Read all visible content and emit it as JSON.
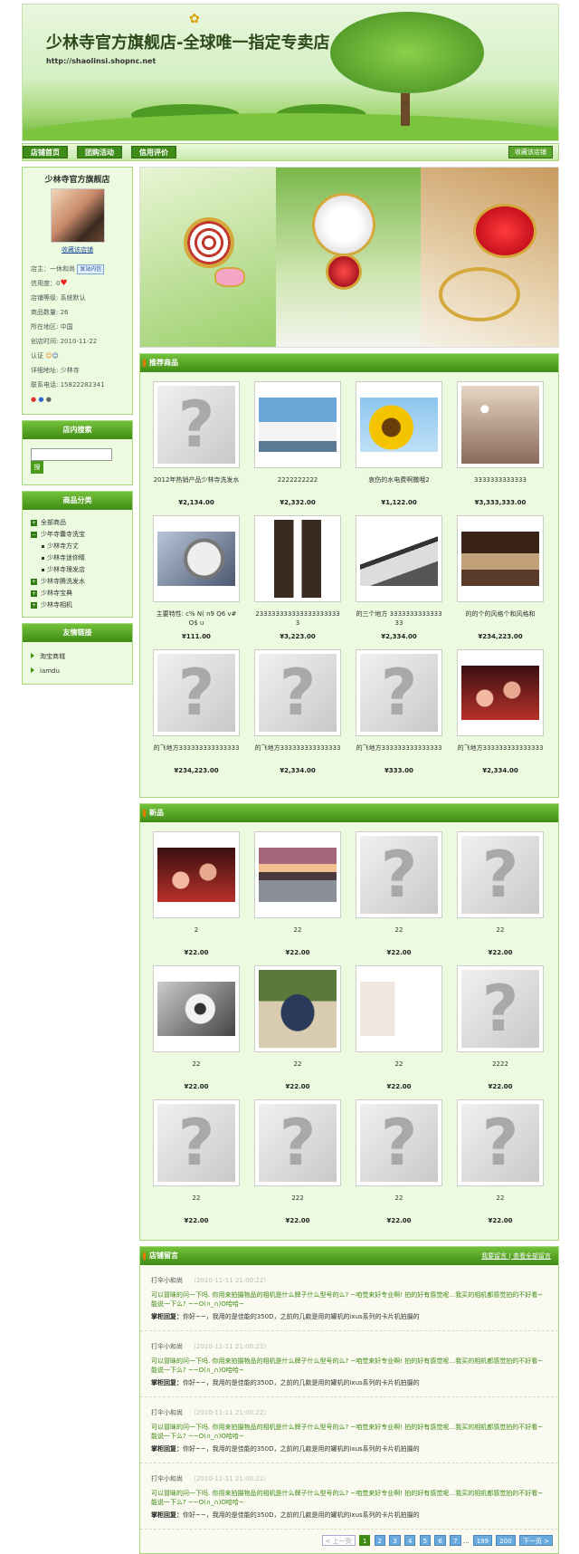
{
  "banner": {
    "title": "少林寺官方旗舰店-全球唯一指定专卖店",
    "url": "http://shaolinsi.shopnc.net"
  },
  "nav": {
    "items": [
      "店铺首页",
      "团购活动",
      "信用评价"
    ],
    "favorite": "收藏该店铺"
  },
  "shop": {
    "name": "少林寺官方旗舰店",
    "collect": "收藏该店铺",
    "owner_label": "店主：",
    "owner": "一休和尚",
    "im_tag": "发站内信",
    "credit_label": "信用度：",
    "credit": "0",
    "level": "店铺等级: 系统默认",
    "goods_count": "商品数量: 26",
    "region": "所在地区: 中国",
    "created": "创店时间: 2010-11-22",
    "verify_label": "认证",
    "address": "详细地址: 少林寺",
    "phone": "联系电话: 15822282341"
  },
  "search": {
    "title": "店内搜索",
    "button": "搜"
  },
  "categories": {
    "title": "商品分类",
    "items": [
      {
        "label": "全部商品",
        "type": "plus"
      },
      {
        "label": "少年寺囊寺洗宝",
        "type": "minus"
      },
      {
        "label": "少林寺方丈",
        "type": "sub"
      },
      {
        "label": "少林寺迷你睛",
        "type": "sub"
      },
      {
        "label": "少林寺理发店",
        "type": "sub"
      },
      {
        "label": "少林寺腾洗发水",
        "type": "plus"
      },
      {
        "label": "少林寺宝典",
        "type": "plus"
      },
      {
        "label": "少林寺相机",
        "type": "plus"
      }
    ]
  },
  "friend_links": {
    "title": "友情链接",
    "items": [
      "淘宝商城",
      "iamdu"
    ]
  },
  "recommended": {
    "title": "推荐商品",
    "goods": [
      {
        "name": "2012年热销产品少林寺洗发水",
        "price": "¥2,134.00",
        "img": "q"
      },
      {
        "name": "2222222222",
        "price": "¥2,332.00",
        "img": "lighthouse"
      },
      {
        "name": "哀伤的水电费啊撒哦2",
        "price": "¥1,122.00",
        "img": "sunflower"
      },
      {
        "name": "3333333333333",
        "price": "¥3,333,333.00",
        "img": "bokeh"
      },
      {
        "name": "主要特性: c% N( n9 Q6 v# O$ u",
        "price": "¥111.00",
        "img": "watch"
      },
      {
        "name": "2333333333333333333333",
        "price": "¥3,223.00",
        "img": "fashion"
      },
      {
        "name": "的三个地方 333333333333333",
        "price": "¥2,334.00",
        "img": "papers"
      },
      {
        "name": "的的个的风格个和风格和",
        "price": "¥234,223.00",
        "img": "room"
      },
      {
        "name": "的飞地方333333333333333",
        "price": "¥234,223.00",
        "img": "q"
      },
      {
        "name": "的飞地方333333333333333",
        "price": "¥2,334.00",
        "img": "q"
      },
      {
        "name": "的飞地方333333333333333",
        "price": "¥333.00",
        "img": "q"
      },
      {
        "name": "的飞地方333333333333333",
        "price": "¥2,334.00",
        "img": "party"
      }
    ]
  },
  "newgoods": {
    "title": "新品",
    "goods": [
      {
        "name": "2",
        "price": "¥22.00",
        "img": "party"
      },
      {
        "name": "22",
        "price": "¥22.00",
        "img": "sunset"
      },
      {
        "name": "22",
        "price": "¥22.00",
        "img": "q"
      },
      {
        "name": "22",
        "price": "¥22.00",
        "img": "q"
      },
      {
        "name": "22",
        "price": "¥22.00",
        "img": "flower"
      },
      {
        "name": "22",
        "price": "¥22.00",
        "img": "girl"
      },
      {
        "name": "22",
        "price": "¥22.00",
        "img": "ad"
      },
      {
        "name": "2222",
        "price": "¥22.00",
        "img": "q"
      },
      {
        "name": "22",
        "price": "¥22.00",
        "img": "q"
      },
      {
        "name": "222",
        "price": "¥22.00",
        "img": "q"
      },
      {
        "name": "22",
        "price": "¥22.00",
        "img": "q"
      },
      {
        "name": "22",
        "price": "¥22.00",
        "img": "q"
      }
    ]
  },
  "messages": {
    "title": "店铺留言",
    "link_my": "我要留言",
    "link_all": "查看全部留言",
    "items": [
      {
        "who": "打伞小和尚",
        "time": "（2010-11-11 21:00:22）",
        "text": "可以冒昧的问一下吗. 你用来拍摄物品的相机是什么牌子什么型号的么? ~咱觉来好专业啊! 拍的好有感觉呢…我买的相机都感觉拍的不好看~能说一下么? ~~O(∩_∩)O哈哈~",
        "reply_label": "掌柜回复：",
        "reply": "你好~~，我用的是佳能的350D，之前的几款是用的罐机的ixus系列的卡片机拍摄的"
      },
      {
        "who": "打伞小和尚",
        "time": "（2010-11-11 21:00:22）",
        "text": "可以冒昧的问一下吗. 你用来拍摄物品的相机是什么牌子什么型号的么? ~咱觉来好专业啊! 拍的好有感觉呢…我买的相机都感觉拍的不好看~能说一下么? ~~O(∩_∩)O哈哈~",
        "reply_label": "掌柜回复：",
        "reply": "你好~~，我用的是佳能的350D，之前的几款是用的罐机的ixus系列的卡片机拍摄的"
      },
      {
        "who": "打伞小和尚",
        "time": "（2010-11-11 21:00:22）",
        "text": "可以冒昧的问一下吗. 你用来拍摄物品的相机是什么牌子什么型号的么? ~咱觉来好专业啊! 拍的好有感觉呢…我买的相机都感觉拍的不好看~能说一下么? ~~O(∩_∩)O哈哈~",
        "reply_label": "掌柜回复：",
        "reply": "你好~~，我用的是佳能的350D，之前的几款是用的罐机的ixus系列的卡片机拍摄的"
      },
      {
        "who": "打伞小和尚",
        "time": "（2010-11-11 21:00:22）",
        "text": "可以冒昧的问一下吗. 你用来拍摄物品的相机是什么牌子什么型号的么? ~咱觉来好专业啊! 拍的好有感觉呢…我买的相机都感觉拍的不好看~能说一下么? ~~O(∩_∩)O哈哈~",
        "reply_label": "掌柜回复：",
        "reply": "你好~~，我用的是佳能的350D，之前的几款是用的罐机的ixus系列的卡片机拍摄的"
      }
    ]
  },
  "pager": {
    "prev": "< 上一页",
    "pages": [
      "1",
      "2",
      "3",
      "4",
      "5",
      "6",
      "7"
    ],
    "ellipsis": "...",
    "tail": [
      "199",
      "200"
    ],
    "next": "下一页 >"
  },
  "colors": {
    "accent": "#3f8b15",
    "panel_bg": "#ecfadf",
    "price": "#222222"
  }
}
